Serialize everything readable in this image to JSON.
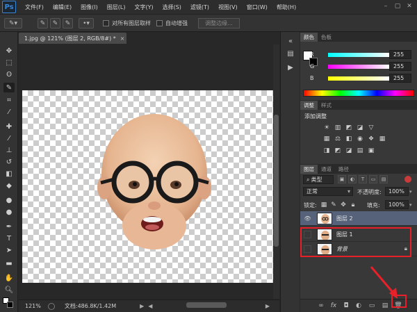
{
  "menubar": {
    "logo": "Ps",
    "items": [
      "文件(F)",
      "编辑(E)",
      "图像(I)",
      "图层(L)",
      "文字(Y)",
      "选择(S)",
      "滤镜(T)",
      "视图(V)",
      "窗口(W)",
      "帮助(H)"
    ],
    "window_buttons": [
      "–",
      "▢",
      "✕"
    ]
  },
  "options": {
    "sample_all_layers": "对所有图层取样",
    "auto_enhance": "自动增强",
    "refine_edge": "调整边缘..."
  },
  "document": {
    "tab_title": "1.jpg @ 121% (图层 2, RGB/8#) *",
    "zoom": "121%",
    "doc_info": "文档:486.8K/1.42M"
  },
  "color_panel": {
    "tabs": [
      "颜色",
      "色板"
    ],
    "channels": [
      {
        "label": "R",
        "value": "255"
      },
      {
        "label": "G",
        "value": "255"
      },
      {
        "label": "B",
        "value": "255"
      }
    ]
  },
  "adjustments_panel": {
    "tabs": [
      "调整",
      "样式"
    ],
    "heading": "添加调整"
  },
  "layers_panel": {
    "tabs": [
      "图层",
      "通道",
      "路径"
    ],
    "filter_kind": "类型",
    "blend_mode": "正常",
    "opacity_label": "不透明度:",
    "opacity_value": "100%",
    "lock_label": "锁定:",
    "fill_label": "填充:",
    "fill_value": "100%",
    "layers": [
      {
        "name": "图层 2",
        "visible": true,
        "selected": true
      },
      {
        "name": "图层 1",
        "visible": false,
        "selected": false
      },
      {
        "name": "背景",
        "visible": false,
        "selected": false,
        "locked": true
      }
    ]
  },
  "colors": {
    "accent_red": "#e8202a",
    "selected_layer": "#56627a",
    "ps_blue": "#3a86d6"
  }
}
